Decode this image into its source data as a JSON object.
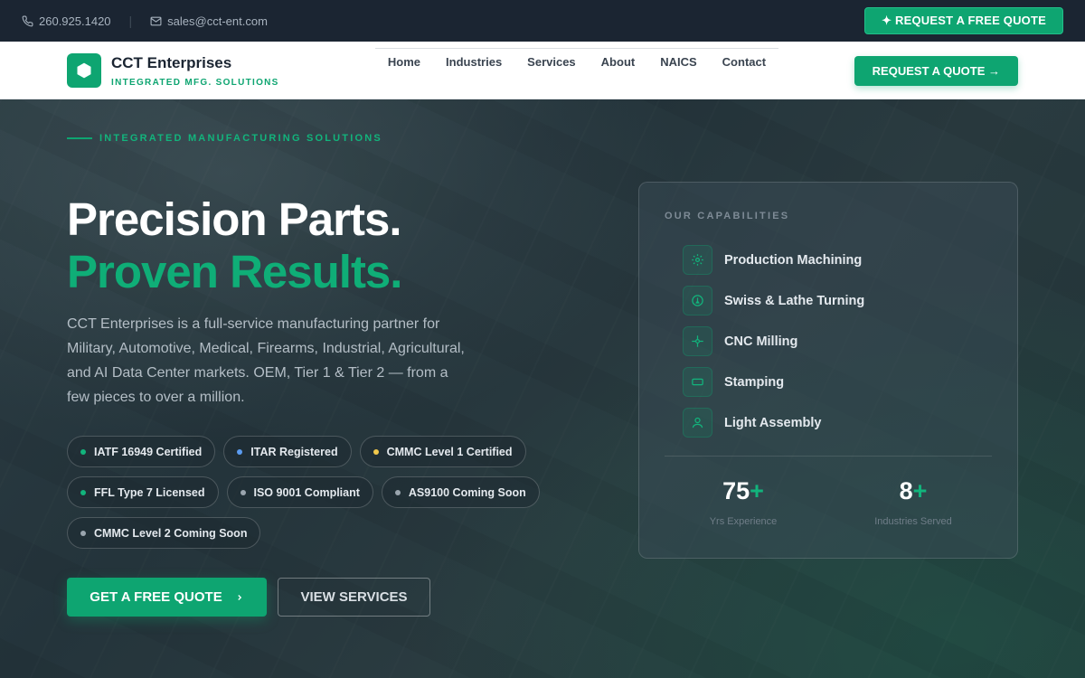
{
  "topbar": {
    "phone": "260.925.1420",
    "email": "sales@cct-ent.com",
    "quote_label": "✦ REQUEST A FREE QUOTE"
  },
  "header": {
    "brand_name": "CCT Enterprises",
    "brand_tagline": "INTEGRATED MFG. SOLUTIONS",
    "nav": [
      "Home",
      "Industries",
      "Services",
      "About",
      "NAICS",
      "Contact"
    ],
    "quote_label": "REQUEST A QUOTE →"
  },
  "hero": {
    "eyebrow": "INTEGRATED MANUFACTURING SOLUTIONS",
    "headline_1": "Precision Parts.",
    "headline_2": "Proven Results.",
    "lead": "CCT Enterprises is a full-service manufacturing partner for Military, Automotive, Medical, Firearms, Industrial, Agricultural, and AI Data Center markets. OEM, Tier 1 & Tier 2 — from a few pieces to over a million.",
    "badges": [
      {
        "label": "IATF 16949 Certified",
        "color": "#12b47c"
      },
      {
        "label": "ITAR Registered",
        "color": "#5b9cf0"
      },
      {
        "label": "CMMC Level 1 Certified",
        "color": "#f2c94c"
      },
      {
        "label": "FFL Type 7 Licensed",
        "color": "#12b47c"
      },
      {
        "label": "ISO 9001 Compliant",
        "color": "#9aa5ae"
      },
      {
        "label": "AS9100 Coming Soon",
        "color": "#9aa5ae"
      },
      {
        "label": "CMMC Level 2 Coming Soon",
        "color": "#9aa5ae"
      }
    ],
    "cta_primary": "GET A FREE QUOTE",
    "cta_secondary": "VIEW SERVICES"
  },
  "capabilities": {
    "title": "OUR CAPABILITIES",
    "items": [
      {
        "label": "Production Machining",
        "icon": "gear-icon"
      },
      {
        "label": "Swiss & Lathe Turning",
        "icon": "turning-icon"
      },
      {
        "label": "CNC Milling",
        "icon": "crosshair-icon"
      },
      {
        "label": "Stamping",
        "icon": "stamp-icon"
      },
      {
        "label": "Light Assembly",
        "icon": "person-icon"
      }
    ],
    "stats": [
      {
        "number": "75",
        "suffix": "+",
        "label": "Yrs Experience"
      },
      {
        "number": "8",
        "suffix": "+",
        "label": "Industries Served"
      }
    ]
  },
  "colors": {
    "accent": "#0ea571",
    "topbar_bg": "#1b2532"
  }
}
